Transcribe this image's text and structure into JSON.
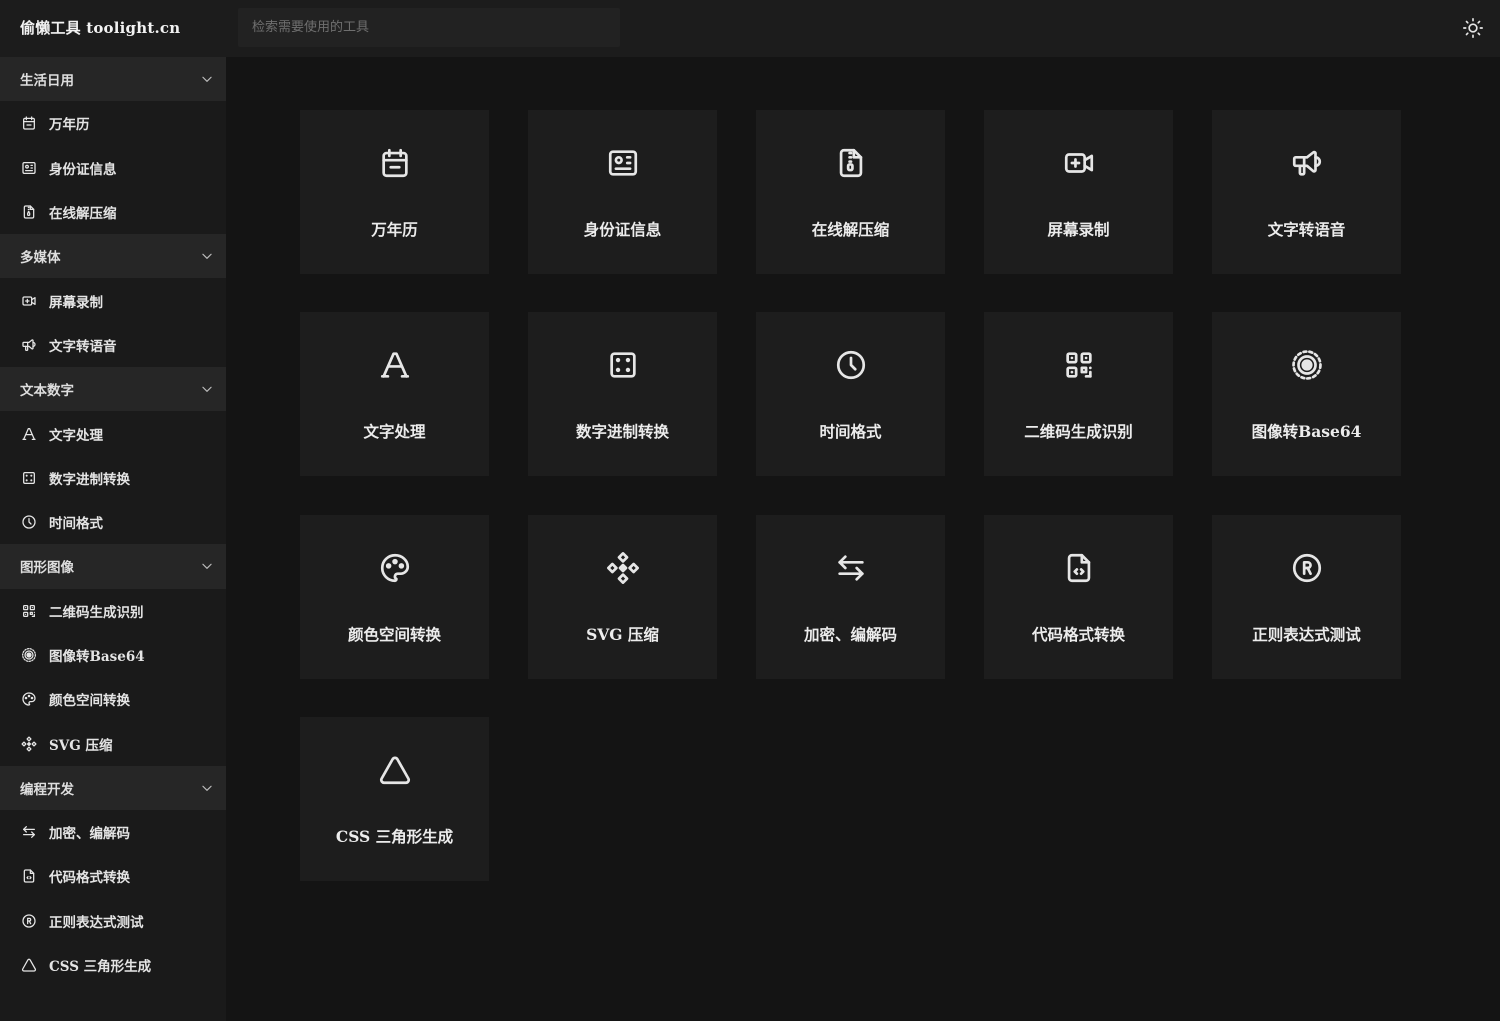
{
  "header": {
    "brand": "偷懒工具 toolight.cn",
    "search_placeholder": "检索需要使用的工具",
    "theme_icon": "sun-icon"
  },
  "sidebar": {
    "groups": [
      {
        "title": "生活日用",
        "items": [
          {
            "label": "万年历",
            "icon": "calendar-icon"
          },
          {
            "label": "身份证信息",
            "icon": "id-card-icon"
          },
          {
            "label": "在线解压缩",
            "icon": "zip-file-icon"
          }
        ]
      },
      {
        "title": "多媒体",
        "items": [
          {
            "label": "屏幕录制",
            "icon": "video-record-icon"
          },
          {
            "label": "文字转语音",
            "icon": "megaphone-icon"
          }
        ]
      },
      {
        "title": "文本数字",
        "items": [
          {
            "label": "文字处理",
            "icon": "letter-a-icon"
          },
          {
            "label": "数字进制转换",
            "icon": "dice-icon"
          },
          {
            "label": "时间格式",
            "icon": "clock-icon"
          }
        ]
      },
      {
        "title": "图形图像",
        "items": [
          {
            "label": "二维码生成识别",
            "icon": "qrcode-icon"
          },
          {
            "label": "图像转Base64",
            "icon": "focus-target-icon"
          },
          {
            "label": "颜色空间转换",
            "icon": "palette-icon"
          },
          {
            "label": "SVG 压缩",
            "icon": "vector-nodes-icon"
          }
        ]
      },
      {
        "title": "编程开发",
        "items": [
          {
            "label": "加密、编解码",
            "icon": "swap-arrows-icon"
          },
          {
            "label": "代码格式转换",
            "icon": "code-file-icon"
          },
          {
            "label": "正则表达式测试",
            "icon": "registered-icon"
          },
          {
            "label": "CSS 三角形生成",
            "icon": "triangle-icon"
          }
        ]
      }
    ]
  },
  "cards": [
    {
      "label": "万年历",
      "icon": "calendar-icon"
    },
    {
      "label": "身份证信息",
      "icon": "id-card-icon"
    },
    {
      "label": "在线解压缩",
      "icon": "zip-file-icon"
    },
    {
      "label": "屏幕录制",
      "icon": "video-record-icon"
    },
    {
      "label": "文字转语音",
      "icon": "megaphone-icon"
    },
    {
      "label": "文字处理",
      "icon": "letter-a-icon"
    },
    {
      "label": "数字进制转换",
      "icon": "dice-icon"
    },
    {
      "label": "时间格式",
      "icon": "clock-icon"
    },
    {
      "label": "二维码生成识别",
      "icon": "qrcode-icon"
    },
    {
      "label": "图像转Base64",
      "icon": "focus-target-icon"
    },
    {
      "label": "颜色空间转换",
      "icon": "palette-icon"
    },
    {
      "label": "SVG 压缩",
      "icon": "vector-nodes-icon"
    },
    {
      "label": "加密、编解码",
      "icon": "swap-arrows-icon"
    },
    {
      "label": "代码格式转换",
      "icon": "code-file-icon"
    },
    {
      "label": "正则表达式测试",
      "icon": "registered-icon"
    },
    {
      "label": "CSS 三角形生成",
      "icon": "triangle-icon"
    }
  ],
  "colors": {
    "background": "#141414",
    "card": "#1d1d1d",
    "sidebar_group": "#262626",
    "text": "#ececec"
  }
}
